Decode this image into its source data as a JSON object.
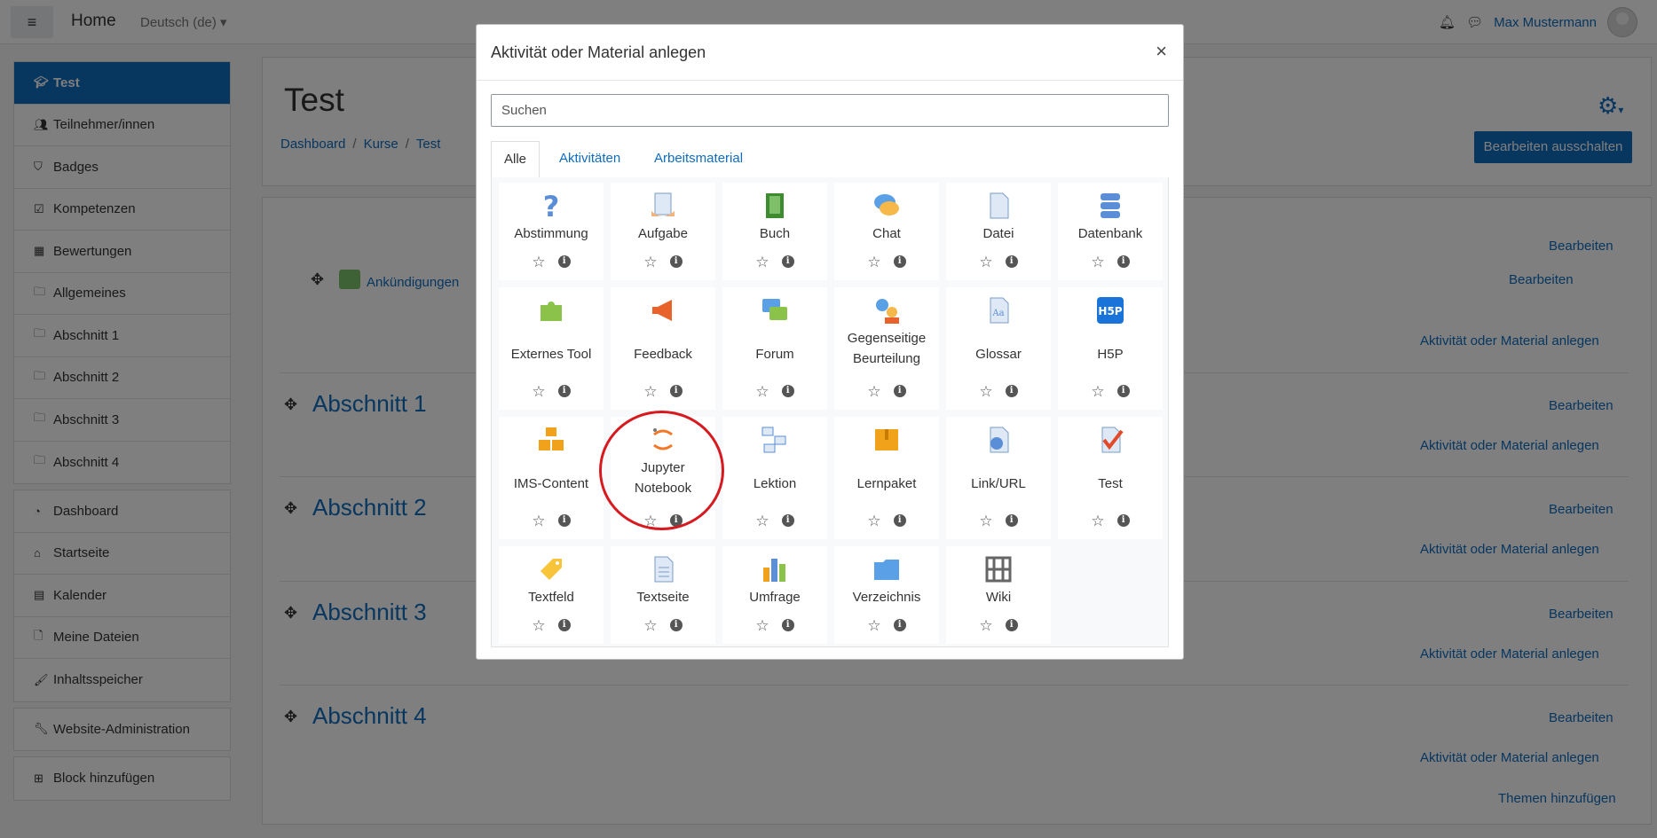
{
  "navbar": {
    "home": "Home",
    "language": "Deutsch (de)",
    "user": "Max Mustermann"
  },
  "drawer": {
    "course": [
      {
        "label": "Test",
        "icon": "graduation-cap-icon"
      },
      {
        "label": "Teilnehmer/innen",
        "icon": "users-icon"
      },
      {
        "label": "Badges",
        "icon": "shield-icon"
      },
      {
        "label": "Kompetenzen",
        "icon": "check-square-icon"
      },
      {
        "label": "Bewertungen",
        "icon": "table-icon"
      },
      {
        "label": "Allgemeines",
        "icon": "folder-icon"
      },
      {
        "label": "Abschnitt 1",
        "icon": "folder-icon"
      },
      {
        "label": "Abschnitt 2",
        "icon": "folder-icon"
      },
      {
        "label": "Abschnitt 3",
        "icon": "folder-icon"
      },
      {
        "label": "Abschnitt 4",
        "icon": "folder-icon"
      }
    ],
    "site": [
      {
        "label": "Dashboard",
        "icon": "tachometer-icon"
      },
      {
        "label": "Startseite",
        "icon": "home-icon"
      },
      {
        "label": "Kalender",
        "icon": "calendar-icon"
      },
      {
        "label": "Meine Dateien",
        "icon": "file-icon"
      },
      {
        "label": "Inhaltsspeicher",
        "icon": "paintbrush-icon"
      }
    ],
    "admin": "Website-Administration",
    "add_block": "Block hinzufügen"
  },
  "course": {
    "title": "Test",
    "breadcrumb": [
      "Dashboard",
      "Kurse",
      "Test"
    ],
    "edit_off": "Bearbeiten ausschalten",
    "edit": "Bearbeiten",
    "announcements": "Ankündigungen",
    "add_activity": "Aktivität oder Material anlegen",
    "sections": [
      "Abschnitt 1",
      "Abschnitt 2",
      "Abschnitt 3",
      "Abschnitt 4"
    ],
    "add_topics": "Themen hinzufügen"
  },
  "modal": {
    "title": "Aktivität oder Material anlegen",
    "close": "×",
    "search_placeholder": "Suchen",
    "tabs": [
      "Alle",
      "Aktivitäten",
      "Arbeitsmaterial"
    ],
    "tiles": [
      {
        "label": "Abstimmung",
        "icon": "question-mark-icon"
      },
      {
        "label": "Aufgabe",
        "icon": "assignment-icon"
      },
      {
        "label": "Buch",
        "icon": "book-icon"
      },
      {
        "label": "Chat",
        "icon": "chat-bubble-icon"
      },
      {
        "label": "Datei",
        "icon": "file-icon"
      },
      {
        "label": "Datenbank",
        "icon": "database-icon"
      },
      {
        "label": "Externes Tool",
        "icon": "puzzle-icon"
      },
      {
        "label": "Feedback",
        "icon": "megaphone-icon"
      },
      {
        "label": "Forum",
        "icon": "forum-icon"
      },
      {
        "label": "Gegenseitige Beurteilung",
        "icon": "workshop-icon"
      },
      {
        "label": "Glossar",
        "icon": "glossary-icon"
      },
      {
        "label": "H5P",
        "icon": "h5p-icon"
      },
      {
        "label": "IMS-Content",
        "icon": "boxes-icon"
      },
      {
        "label": "Jupyter Notebook",
        "icon": "jupyter-icon"
      },
      {
        "label": "Lektion",
        "icon": "lesson-icon"
      },
      {
        "label": "Lernpaket",
        "icon": "package-icon"
      },
      {
        "label": "Link/URL",
        "icon": "url-icon"
      },
      {
        "label": "Test",
        "icon": "quiz-icon"
      },
      {
        "label": "Textfeld",
        "icon": "label-tag-icon"
      },
      {
        "label": "Textseite",
        "icon": "page-icon"
      },
      {
        "label": "Umfrage",
        "icon": "bar-chart-icon"
      },
      {
        "label": "Verzeichnis",
        "icon": "folder-icon"
      },
      {
        "label": "Wiki",
        "icon": "wiki-icon"
      }
    ]
  }
}
